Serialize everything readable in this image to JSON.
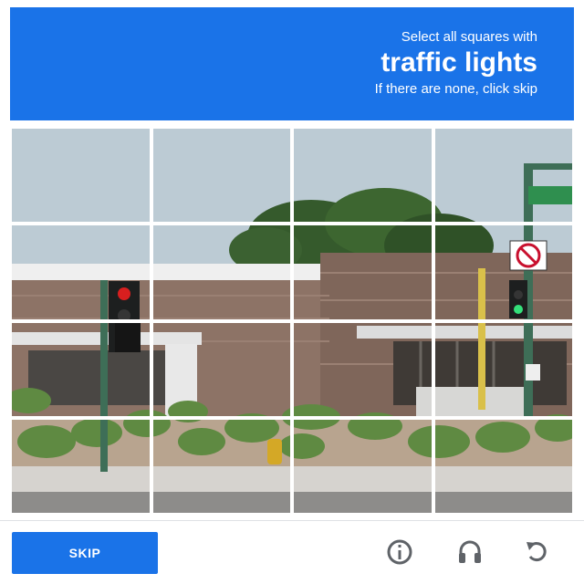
{
  "prompt": {
    "line1": "Select all squares with",
    "target": "traffic lights",
    "line3": "If there are none, click skip"
  },
  "grid": {
    "rows": 4,
    "cols": 4
  },
  "scene": {
    "street_sign": "NO P"
  },
  "footer": {
    "skip_label": "SKIP",
    "icons": [
      "reload-icon",
      "audio-icon",
      "info-icon"
    ]
  },
  "colors": {
    "accent": "#1a73e8",
    "sky": "#c3d0d8",
    "brick": "#8a7166",
    "pole": "#3e6e57",
    "shrub": "#5f8a42"
  }
}
